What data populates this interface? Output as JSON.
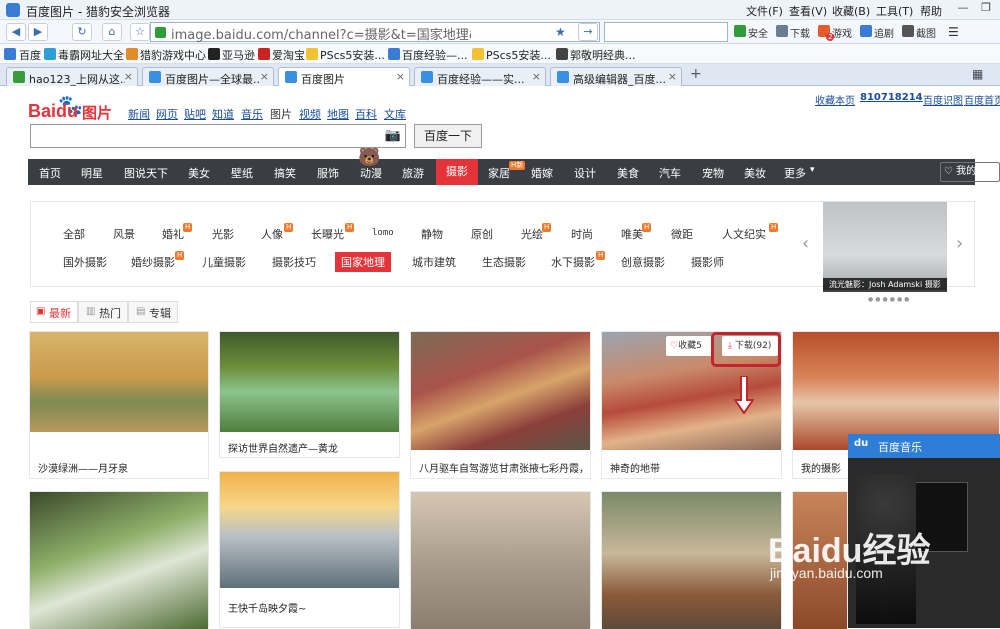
{
  "window": {
    "title": "百度图片 - 猎豹安全浏览器",
    "menus": [
      "文件(F)",
      "查看(V)",
      "收藏(B)",
      "工具(T)",
      "帮助"
    ]
  },
  "address": {
    "url": "image.baidu.com/channel?c=摄影&t=国家地理&s",
    "toolbar": [
      "安全",
      "下载",
      "游戏",
      "追剧",
      "截图"
    ],
    "game_badge": "2"
  },
  "bookmarks": [
    "百度",
    "毒霸网址大全",
    "猎豹游戏中心",
    "亚马逊",
    "爱淘宝",
    "PScs5安装...",
    "PScs5安装...",
    "百度经验—...",
    "PScs5安装...",
    "郭敬明经典..."
  ],
  "tabs": [
    {
      "label": "hao123_上网从这...",
      "active": false
    },
    {
      "label": "百度图片—全球最...",
      "active": false
    },
    {
      "label": "百度图片",
      "active": true
    },
    {
      "label": "百度经验——实...",
      "active": false
    },
    {
      "label": "高级编辑器_百度...",
      "active": false
    }
  ],
  "page": {
    "logo_text_bai": "Bai",
    "logo_text_du": "du",
    "logo_text_pic": "图片",
    "nav_links": [
      "新闻",
      "网页",
      "贴吧",
      "知道",
      "音乐",
      "图片",
      "视频",
      "地图",
      "百科",
      "文库"
    ],
    "top_right": [
      "收藏本页",
      "810718214",
      "百度识图",
      "百度首页"
    ],
    "search_button": "百度一下",
    "categories": [
      "首页",
      "明星",
      "图说天下",
      "美女",
      "壁纸",
      "搞笑",
      "服饰",
      "动漫",
      "旅游",
      "摄影",
      "家居",
      "婚嫁",
      "设计",
      "美食",
      "汽车",
      "宠物",
      "美妆",
      "更多"
    ],
    "category_hot": "H新",
    "active_category": "摄影",
    "my_pictures": "我的图片",
    "sub_row1": [
      "全部",
      "风景",
      "婚礼",
      "光影",
      "人像",
      "长曝光",
      "lomo",
      "静物",
      "原创",
      "光绘",
      "时尚",
      "唯美",
      "微距",
      "人文纪实"
    ],
    "sub_row2": [
      "国外摄影",
      "婚纱摄影",
      "儿童摄影",
      "摄影技巧",
      "国家地理",
      "城市建筑",
      "生态摄影",
      "水下摄影",
      "创意摄影",
      "摄影师"
    ],
    "sub_hot_badge": "H",
    "active_sub": "国家地理",
    "carousel_caption": "流光魅影：Josh Adamski 摄影",
    "sort_tabs": [
      "最新",
      "热门",
      "专辑"
    ],
    "cards": [
      {
        "caption": "沙漠绿洲——月牙泉"
      },
      {
        "caption": "探访世界自然遗产—黄龙"
      },
      {
        "caption": "八月驱车自驾游览甘肃张掖七彩丹霞，去..."
      },
      {
        "caption": "神奇的地带"
      },
      {
        "caption": "我的摄影"
      },
      {
        "caption": ""
      },
      {
        "caption": "王快千岛映夕霞~"
      },
      {
        "caption": ""
      },
      {
        "caption": ""
      },
      {
        "caption": ""
      }
    ],
    "collect_label": "收藏",
    "collect_count": "5",
    "download_label": "下载",
    "download_count": "(92)",
    "music_title": "百度音乐",
    "watermark_main": "Baidu经验",
    "watermark_sub": "jingyan.baidu.com"
  },
  "colors": {
    "accent_red": "#e4343a",
    "nav_dark": "#3a3d43",
    "link_blue": "#1a4d99",
    "music_blue": "#2e7ed7"
  }
}
